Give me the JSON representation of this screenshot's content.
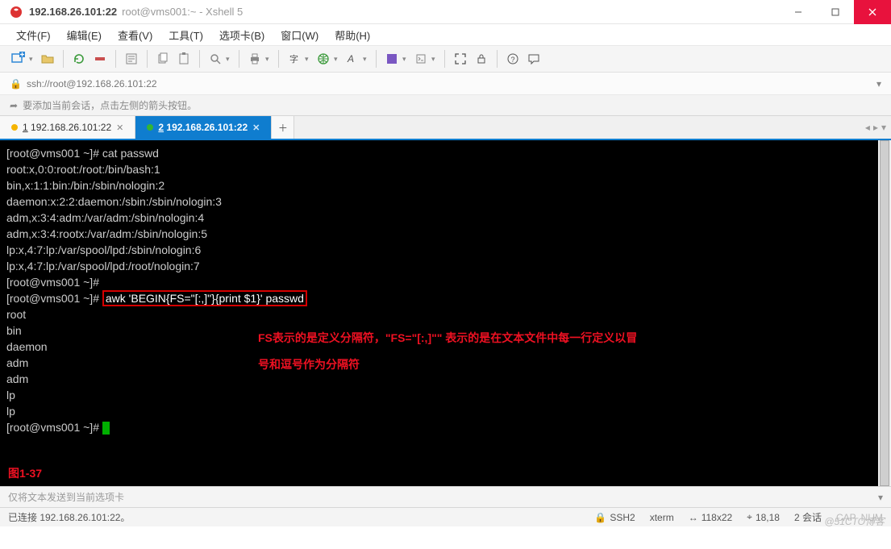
{
  "titlebar": {
    "host": "192.168.26.101:22",
    "session": "root@vms001:~ - Xshell 5"
  },
  "menu": {
    "file": "文件(F)",
    "edit": "编辑(E)",
    "view": "查看(V)",
    "tools": "工具(T)",
    "tabs": "选项卡(B)",
    "window": "窗口(W)",
    "help": "帮助(H)"
  },
  "addrbar": {
    "url": "ssh://root@192.168.26.101:22"
  },
  "hintbar": {
    "text": "要添加当前会话，点击左侧的箭头按钮。"
  },
  "tabs": {
    "items": [
      {
        "idx": "1",
        "label": "192.168.26.101:22",
        "dot": "#f5b400",
        "active": false
      },
      {
        "idx": "2",
        "label": "192.168.26.101:22",
        "dot": "#33b533",
        "active": true
      }
    ]
  },
  "terminal": {
    "lines": [
      "[root@vms001 ~]# cat passwd",
      "root:x,0:0:root:/root:/bin/bash:1",
      "bin,x:1:1:bin:/bin:/sbin/nologin:2",
      "daemon:x:2:2:daemon:/sbin:/sbin/nologin:3",
      "adm,x:3:4:adm:/var/adm:/sbin/nologin:4",
      "adm,x:3:4:rootx:/var/adm:/sbin/nologin:5",
      "lp:x,4:7:lp:/var/spool/lpd:/sbin/nologin:6",
      "lp:x,4:7:lp:/var/spool/lpd:/root/nologin:7",
      "[root@vms001 ~]#"
    ],
    "cmd_prompt": "[root@vms001 ~]# ",
    "cmd_highlight": "awk 'BEGIN{FS=\"[:,]\"}{print $1}' passwd",
    "output": [
      "root",
      "bin",
      "daemon",
      "adm",
      "adm",
      "lp",
      "lp"
    ],
    "prompt_end": "[root@vms001 ~]# ",
    "annotation_l1": "FS表示的是定义分隔符，\"FS=\"[:,]\"\" 表示的是在文本文件中每一行定义以冒",
    "annotation_l2": "号和逗号作为分隔符",
    "figure": "图1-37"
  },
  "inputbar": {
    "placeholder": "仅将文本发送到当前选项卡"
  },
  "statusbar": {
    "conn": "已连接 192.168.26.101:22。",
    "proto": "SSH2",
    "term": "xterm",
    "size": "118x22",
    "pos": "18,18",
    "sessions": "2 会话",
    "caps": "CAP",
    "num": "NUM"
  },
  "watermark": "@51CTO博客",
  "colors": {
    "accent": "#0f7dcf",
    "close": "#e8123d",
    "redbox": "#d40000"
  }
}
